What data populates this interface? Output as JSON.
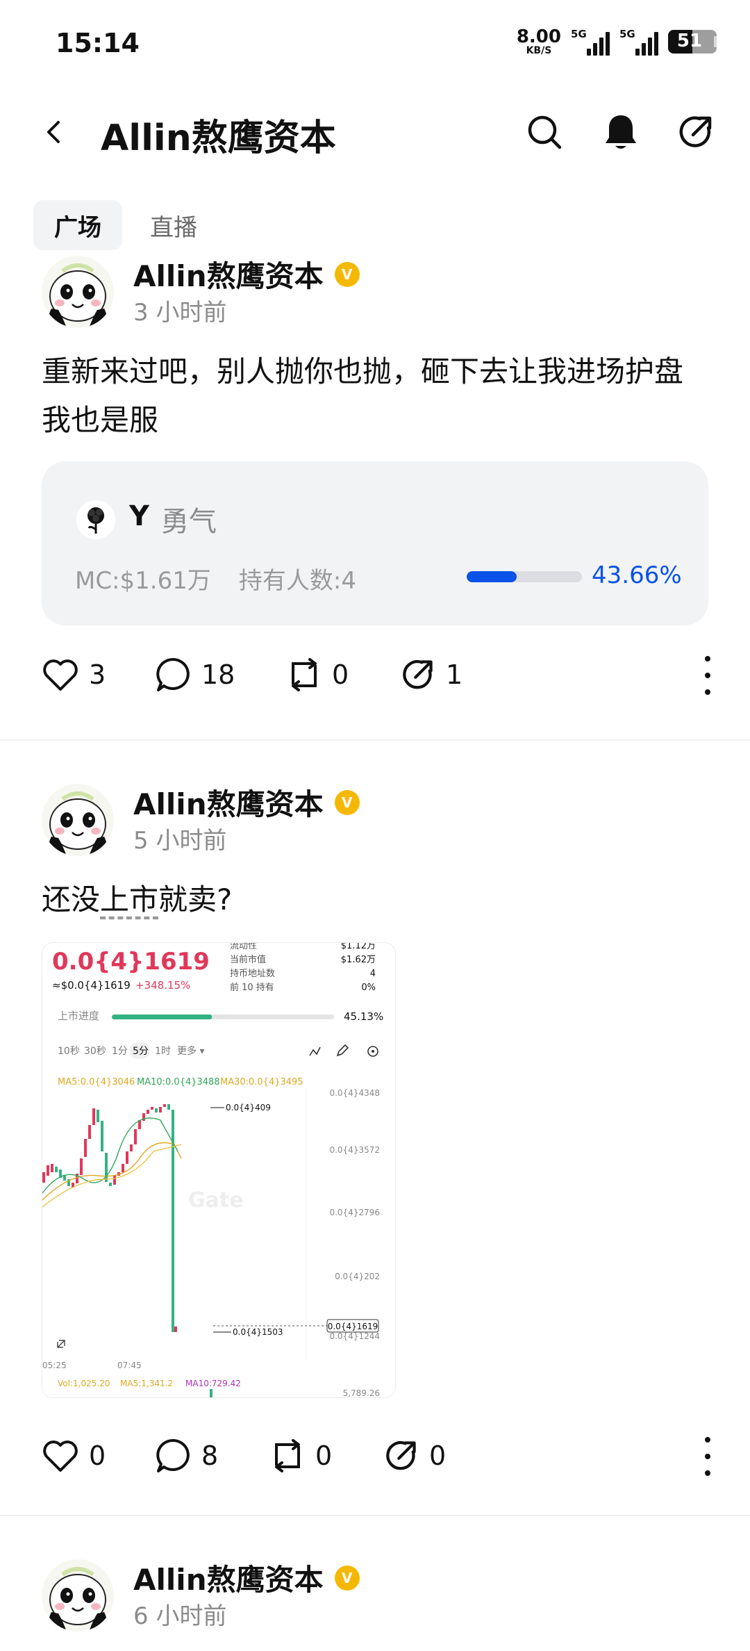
{
  "status": {
    "time": "15:14",
    "speed_value": "8.00",
    "speed_unit": "KB/S",
    "net1": "5G",
    "net2": "5G",
    "battery": "51"
  },
  "header": {
    "title": "Allin熬鹰资本"
  },
  "tabs": [
    {
      "label": "广场"
    },
    {
      "label": "直播"
    }
  ],
  "posts": [
    {
      "author": "Allin熬鹰资本",
      "verified": "V",
      "time": "3 小时前",
      "text": "重新来过吧，别人抛你也抛，砸下去让我进场护盘我也是服",
      "token": {
        "symbol": "Y",
        "name": "勇气",
        "mc": "MC:$1.61万",
        "holders": "持有人数:4",
        "progress": 0.4366,
        "progress_label": "43.66%"
      },
      "actions": {
        "likes": "3",
        "comments": "18",
        "reposts": "0",
        "shares": "1"
      }
    },
    {
      "author": "Allin熬鹰资本",
      "verified": "V",
      "time": "5 小时前",
      "text_before": "还没",
      "text_dotted": "上市",
      "text_after": "就卖?",
      "chart": {
        "price_big": "0.0{4}1619",
        "price_small": "≈$0.0{4}1619",
        "change": "+348.15%",
        "stats": [
          {
            "label": "流动性",
            "value": "$1.12万"
          },
          {
            "label": "当前市值",
            "value": "$1.62万"
          },
          {
            "label": "持币地址数",
            "value": "4"
          },
          {
            "label": "前 10 持有",
            "value": "0%"
          }
        ],
        "listing_label": "上市进度",
        "listing_progress": 0.4513,
        "listing_value": "45.13%",
        "intervals": [
          "10秒",
          "30秒",
          "1分",
          "5分",
          "1时",
          "更多 ▾"
        ],
        "active_interval": "5分",
        "ma5": "MA5:0.0{4}3046",
        "ma10": "MA10:0.0{4}3488",
        "ma30": "MA30:0.0{4}3495",
        "y_labels": [
          "0.0{4}4348",
          "0.0{4}3572",
          "0.0{4}2796",
          "0.0{4}202",
          "0.0{4}1244"
        ],
        "high_label": "0.0{4}409",
        "low_label": "0.0{4}1503",
        "current_label": "0.0{4}1619",
        "x_labels": [
          "05:25",
          "07:45"
        ],
        "vol": "Vol:1,025.20",
        "vol_ma5": "MA5:1,341.2",
        "vol_ma10": "MA10:729.42",
        "vol_max": "5,789.26",
        "watermark": "Gate"
      },
      "actions": {
        "likes": "0",
        "comments": "8",
        "reposts": "0",
        "shares": "0"
      }
    },
    {
      "author": "Allin熬鹰资本",
      "verified": "V",
      "time": "6 小时前"
    }
  ]
}
